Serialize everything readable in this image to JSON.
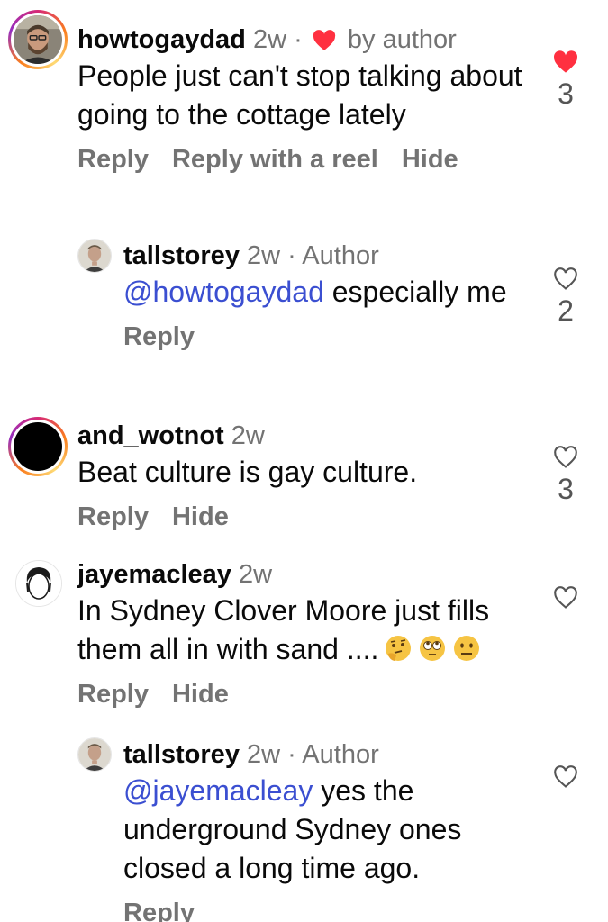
{
  "comments": [
    {
      "username": "howtogaydad",
      "time": "2w",
      "separator": "·",
      "liked_by_author_label": "by author",
      "text": "People just can't stop talking about going to the cottage lately",
      "actions": [
        "Reply",
        "Reply with a reel",
        "Hide"
      ],
      "likes": "3",
      "liked": true
    },
    {
      "username": "tallstorey",
      "time": "2w",
      "separator": "·",
      "role": "Author",
      "mention": "@howtogaydad",
      "text": " especially me",
      "actions": [
        "Reply"
      ],
      "likes": "2",
      "liked": false
    },
    {
      "username": "and_wotnot",
      "time": "2w",
      "text": "Beat culture is gay culture.",
      "actions": [
        "Reply",
        "Hide"
      ],
      "likes": "3",
      "liked": false
    },
    {
      "username": "jayemacleay",
      "time": "2w",
      "text": "In Sydney Clover Moore just fills them all in with sand ....",
      "emojis": [
        "thinking-face-emoji",
        "rolling-eyes-emoji",
        "neutral-face-emoji"
      ],
      "actions": [
        "Reply",
        "Hide"
      ],
      "likes": "",
      "liked": false
    },
    {
      "username": "tallstorey",
      "time": "2w",
      "separator": "·",
      "role": "Author",
      "mention": "@jayemacleay",
      "text": " yes the underground Sydney ones closed a long time ago.",
      "actions": [
        "Reply"
      ],
      "likes": "",
      "liked": false
    }
  ],
  "colors": {
    "like_red": "#ff3040",
    "mention_blue": "#3b4fd1",
    "muted_gray": "#737373"
  }
}
